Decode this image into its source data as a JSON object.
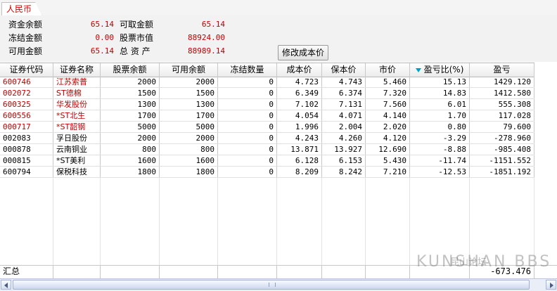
{
  "tab": {
    "label": "人民币"
  },
  "summary": {
    "rows": [
      {
        "label": "资金余额",
        "value": "65.14",
        "label2": "可取金额",
        "value2": "65.14"
      },
      {
        "label": "冻结金额",
        "value": "0.00",
        "label2": "股票市值",
        "value2": "88924.00"
      },
      {
        "label": "可用金额",
        "value": "65.14",
        "label2": "总 资 产",
        "value2": "88989.14"
      }
    ],
    "modify_cost_button": "修改成本价"
  },
  "table": {
    "headers": [
      "证券代码",
      "证券名称",
      "股票余额",
      "可用余额",
      "冻结数量",
      "成本价",
      "保本价",
      "市价",
      "盈亏比(%)",
      "盈亏"
    ],
    "rows": [
      {
        "code": "600746",
        "name": "江苏索普",
        "balance": "2000",
        "available": "2000",
        "frozen": "0",
        "cost": "4.723",
        "breakeven": "4.743",
        "price": "5.460",
        "pl_pct": "15.13",
        "pl": "1429.120",
        "gain": true
      },
      {
        "code": "002072",
        "name": "ST德棉",
        "balance": "1500",
        "available": "1500",
        "frozen": "0",
        "cost": "6.349",
        "breakeven": "6.374",
        "price": "7.320",
        "pl_pct": "14.83",
        "pl": "1412.580",
        "gain": true
      },
      {
        "code": "600325",
        "name": "华发股份",
        "balance": "1300",
        "available": "1300",
        "frozen": "0",
        "cost": "7.102",
        "breakeven": "7.131",
        "price": "7.560",
        "pl_pct": "6.01",
        "pl": "555.308",
        "gain": true
      },
      {
        "code": "600556",
        "name": "*ST北生",
        "balance": "1700",
        "available": "1700",
        "frozen": "0",
        "cost": "4.054",
        "breakeven": "4.071",
        "price": "4.140",
        "pl_pct": "1.70",
        "pl": "117.028",
        "gain": true
      },
      {
        "code": "000717",
        "name": "*ST韶钢",
        "balance": "5000",
        "available": "5000",
        "frozen": "0",
        "cost": "1.996",
        "breakeven": "2.004",
        "price": "2.020",
        "pl_pct": "0.80",
        "pl": "79.600",
        "gain": true
      },
      {
        "code": "002083",
        "name": "孚日股份",
        "balance": "2000",
        "available": "2000",
        "frozen": "0",
        "cost": "4.243",
        "breakeven": "4.260",
        "price": "4.120",
        "pl_pct": "-3.29",
        "pl": "-278.960",
        "gain": false
      },
      {
        "code": "000878",
        "name": "云南铜业",
        "balance": "800",
        "available": "800",
        "frozen": "0",
        "cost": "13.871",
        "breakeven": "13.927",
        "price": "12.690",
        "pl_pct": "-8.88",
        "pl": "-985.408",
        "gain": false
      },
      {
        "code": "000815",
        "name": "*ST美利",
        "balance": "1600",
        "available": "1600",
        "frozen": "0",
        "cost": "6.128",
        "breakeven": "6.153",
        "price": "5.430",
        "pl_pct": "-11.74",
        "pl": "-1151.552",
        "gain": false
      },
      {
        "code": "600794",
        "name": "保税科技",
        "balance": "1800",
        "available": "1800",
        "frozen": "0",
        "cost": "8.209",
        "breakeven": "8.242",
        "price": "7.210",
        "pl_pct": "-12.53",
        "pl": "-1851.192",
        "gain": false
      }
    ],
    "footer_label": "汇总",
    "footer_total": "-673.476"
  },
  "watermark": {
    "line1": "昆山论坛",
    "line2": "KUNSHAN BBS"
  },
  "colors": {
    "gain": "#c00000",
    "loss": "#000000",
    "tab_text": "#d20000",
    "sort_icon": "#00a0c0"
  },
  "icons": {
    "sort": "sort-desc-icon"
  }
}
